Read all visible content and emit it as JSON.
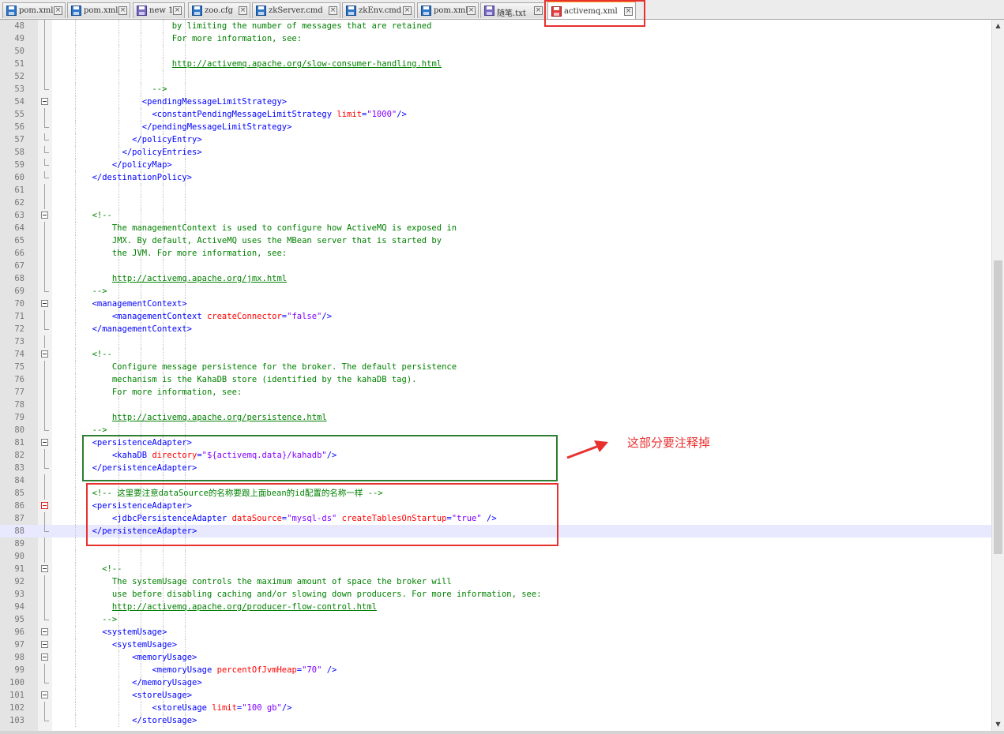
{
  "tabs": [
    {
      "label": "pom.xml",
      "icon": "saved-file-icon",
      "active": false
    },
    {
      "label": "pom.xml",
      "icon": "saved-file-icon",
      "active": false
    },
    {
      "label": "new 1",
      "icon": "unsaved-file-icon",
      "active": false
    },
    {
      "label": "zoo.cfg",
      "icon": "saved-file-icon",
      "active": false
    },
    {
      "label": "zkServer.cmd",
      "icon": "saved-file-icon",
      "active": false
    },
    {
      "label": "zkEnv.cmd",
      "icon": "saved-file-icon",
      "active": false
    },
    {
      "label": "pom.xml",
      "icon": "saved-file-icon",
      "active": false
    },
    {
      "label": "随笔.txt",
      "icon": "unsaved-file-icon",
      "active": false
    },
    {
      "label": "activemq.xml",
      "icon": "modified-file-icon",
      "active": true
    }
  ],
  "colors": {
    "tag": "#0000ff",
    "attribute": "#ff0000",
    "string": "#8000ff",
    "comment": "#008000",
    "current_line": "#e8e8ff",
    "annotation_green": "#2e7d32",
    "annotation_red": "#e8312f"
  },
  "annotation": {
    "note": "这部分要注释掉"
  },
  "lines": [
    {
      "n": "48",
      "segs": [
        [
          "cm",
          "                        by limiting the number of messages that are retained"
        ]
      ]
    },
    {
      "n": "49",
      "segs": [
        [
          "cm",
          "                        For more information, see:"
        ]
      ]
    },
    {
      "n": "50",
      "segs": []
    },
    {
      "n": "51",
      "segs": [
        [
          "pl",
          "                        "
        ],
        [
          "url",
          "http://activemq.apache.org/slow-consumer-handling.html"
        ]
      ]
    },
    {
      "n": "52",
      "segs": []
    },
    {
      "n": "53",
      "segs": [
        [
          "cm",
          "                    -->"
        ]
      ]
    },
    {
      "n": "54",
      "segs": [
        [
          "pl",
          "                  "
        ],
        [
          "tag",
          "<pendingMessageLimitStrategy>"
        ]
      ]
    },
    {
      "n": "55",
      "segs": [
        [
          "pl",
          "                    "
        ],
        [
          "tag",
          "<constantPendingMessageLimitStrategy "
        ],
        [
          "attr",
          "limit"
        ],
        [
          "tag",
          "="
        ],
        [
          "str",
          "\"1000\""
        ],
        [
          "tag",
          "/>"
        ]
      ]
    },
    {
      "n": "56",
      "segs": [
        [
          "pl",
          "                  "
        ],
        [
          "tag",
          "</pendingMessageLimitStrategy>"
        ]
      ]
    },
    {
      "n": "57",
      "segs": [
        [
          "pl",
          "                "
        ],
        [
          "tag",
          "</policyEntry>"
        ]
      ]
    },
    {
      "n": "58",
      "segs": [
        [
          "pl",
          "              "
        ],
        [
          "tag",
          "</policyEntries>"
        ]
      ]
    },
    {
      "n": "59",
      "segs": [
        [
          "pl",
          "            "
        ],
        [
          "tag",
          "</policyMap>"
        ]
      ]
    },
    {
      "n": "60",
      "segs": [
        [
          "pl",
          "        "
        ],
        [
          "tag",
          "</destinationPolicy>"
        ]
      ]
    },
    {
      "n": "61",
      "segs": []
    },
    {
      "n": "62",
      "segs": []
    },
    {
      "n": "63",
      "segs": [
        [
          "cm",
          "        <!--"
        ]
      ]
    },
    {
      "n": "64",
      "segs": [
        [
          "cm",
          "            The managementContext is used to configure how ActiveMQ is exposed in"
        ]
      ]
    },
    {
      "n": "65",
      "segs": [
        [
          "cm",
          "            JMX. By default, ActiveMQ uses the MBean server that is started by"
        ]
      ]
    },
    {
      "n": "66",
      "segs": [
        [
          "cm",
          "            the JVM. For more information, see:"
        ]
      ]
    },
    {
      "n": "67",
      "segs": []
    },
    {
      "n": "68",
      "segs": [
        [
          "pl",
          "            "
        ],
        [
          "url",
          "http://activemq.apache.org/jmx.html"
        ]
      ]
    },
    {
      "n": "69",
      "segs": [
        [
          "cm",
          "        -->"
        ]
      ]
    },
    {
      "n": "70",
      "segs": [
        [
          "pl",
          "        "
        ],
        [
          "tag",
          "<managementContext>"
        ]
      ]
    },
    {
      "n": "71",
      "segs": [
        [
          "pl",
          "            "
        ],
        [
          "tag",
          "<managementContext "
        ],
        [
          "attr",
          "createConnector"
        ],
        [
          "tag",
          "="
        ],
        [
          "str",
          "\"false\""
        ],
        [
          "tag",
          "/>"
        ]
      ]
    },
    {
      "n": "72",
      "segs": [
        [
          "pl",
          "        "
        ],
        [
          "tag",
          "</managementContext>"
        ]
      ]
    },
    {
      "n": "73",
      "segs": []
    },
    {
      "n": "74",
      "segs": [
        [
          "cm",
          "        <!--"
        ]
      ]
    },
    {
      "n": "75",
      "segs": [
        [
          "cm",
          "            Configure message persistence for the broker. The default persistence"
        ]
      ]
    },
    {
      "n": "76",
      "segs": [
        [
          "cm",
          "            mechanism is the KahaDB store (identified by the kahaDB tag)."
        ]
      ]
    },
    {
      "n": "77",
      "segs": [
        [
          "cm",
          "            For more information, see:"
        ]
      ]
    },
    {
      "n": "78",
      "segs": []
    },
    {
      "n": "79",
      "segs": [
        [
          "pl",
          "            "
        ],
        [
          "url",
          "http://activemq.apache.org/persistence.html"
        ]
      ]
    },
    {
      "n": "80",
      "segs": [
        [
          "cm",
          "        -->"
        ]
      ]
    },
    {
      "n": "81",
      "segs": [
        [
          "pl",
          "        "
        ],
        [
          "tag",
          "<persistenceAdapter>"
        ]
      ]
    },
    {
      "n": "82",
      "segs": [
        [
          "pl",
          "            "
        ],
        [
          "tag",
          "<kahaDB "
        ],
        [
          "attr",
          "directory"
        ],
        [
          "tag",
          "="
        ],
        [
          "str",
          "\"${activemq.data}/kahadb\""
        ],
        [
          "tag",
          "/>"
        ]
      ]
    },
    {
      "n": "83",
      "segs": [
        [
          "pl",
          "        "
        ],
        [
          "tag",
          "</persistenceAdapter>"
        ]
      ]
    },
    {
      "n": "84",
      "segs": []
    },
    {
      "n": "85",
      "segs": [
        [
          "cm",
          "        <!-- 这里要注意dataSource的名称要跟上面bean的id配置的名称一样 -->"
        ]
      ]
    },
    {
      "n": "86",
      "segs": [
        [
          "pl",
          "        "
        ],
        [
          "tag",
          "<persistenceAdapter>"
        ]
      ]
    },
    {
      "n": "87",
      "segs": [
        [
          "pl",
          "            "
        ],
        [
          "tag",
          "<jdbcPersistenceAdapter "
        ],
        [
          "attr",
          "dataSource"
        ],
        [
          "tag",
          "="
        ],
        [
          "str",
          "\"mysql-ds\""
        ],
        [
          "pl",
          " "
        ],
        [
          "attr",
          "createTablesOnStartup"
        ],
        [
          "tag",
          "="
        ],
        [
          "str",
          "\"true\""
        ],
        [
          "pl",
          " "
        ],
        [
          "tag",
          "/>"
        ]
      ]
    },
    {
      "n": "88",
      "segs": [
        [
          "pl",
          "        "
        ],
        [
          "tag",
          "</persistenceAdapter>"
        ]
      ]
    },
    {
      "n": "89",
      "segs": []
    },
    {
      "n": "90",
      "segs": []
    },
    {
      "n": "91",
      "segs": [
        [
          "cm",
          "          <!--"
        ]
      ]
    },
    {
      "n": "92",
      "segs": [
        [
          "cm",
          "            The systemUsage controls the maximum amount of space the broker will"
        ]
      ]
    },
    {
      "n": "93",
      "segs": [
        [
          "cm",
          "            use before disabling caching and/or slowing down producers. For more information, see:"
        ]
      ]
    },
    {
      "n": "94",
      "segs": [
        [
          "pl",
          "            "
        ],
        [
          "url",
          "http://activemq.apache.org/producer-flow-control.html"
        ]
      ]
    },
    {
      "n": "95",
      "segs": [
        [
          "cm",
          "          -->"
        ]
      ]
    },
    {
      "n": "96",
      "segs": [
        [
          "pl",
          "          "
        ],
        [
          "tag",
          "<systemUsage>"
        ]
      ]
    },
    {
      "n": "97",
      "segs": [
        [
          "pl",
          "            "
        ],
        [
          "tag",
          "<systemUsage>"
        ]
      ]
    },
    {
      "n": "98",
      "segs": [
        [
          "pl",
          "                "
        ],
        [
          "tag",
          "<memoryUsage>"
        ]
      ]
    },
    {
      "n": "99",
      "segs": [
        [
          "pl",
          "                    "
        ],
        [
          "tag",
          "<memoryUsage "
        ],
        [
          "attr",
          "percentOfJvmHeap"
        ],
        [
          "tag",
          "="
        ],
        [
          "str",
          "\"70\""
        ],
        [
          "pl",
          " "
        ],
        [
          "tag",
          "/>"
        ]
      ]
    },
    {
      "n": "100",
      "segs": [
        [
          "pl",
          "                "
        ],
        [
          "tag",
          "</memoryUsage>"
        ]
      ]
    },
    {
      "n": "101",
      "segs": [
        [
          "pl",
          "                "
        ],
        [
          "tag",
          "<storeUsage>"
        ]
      ]
    },
    {
      "n": "102",
      "segs": [
        [
          "pl",
          "                    "
        ],
        [
          "tag",
          "<storeUsage "
        ],
        [
          "attr",
          "limit"
        ],
        [
          "tag",
          "="
        ],
        [
          "str",
          "\"100 gb\""
        ],
        [
          "tag",
          "/>"
        ]
      ]
    },
    {
      "n": "103",
      "segs": [
        [
          "pl",
          "                "
        ],
        [
          "tag",
          "</storeUsage>"
        ]
      ]
    }
  ]
}
